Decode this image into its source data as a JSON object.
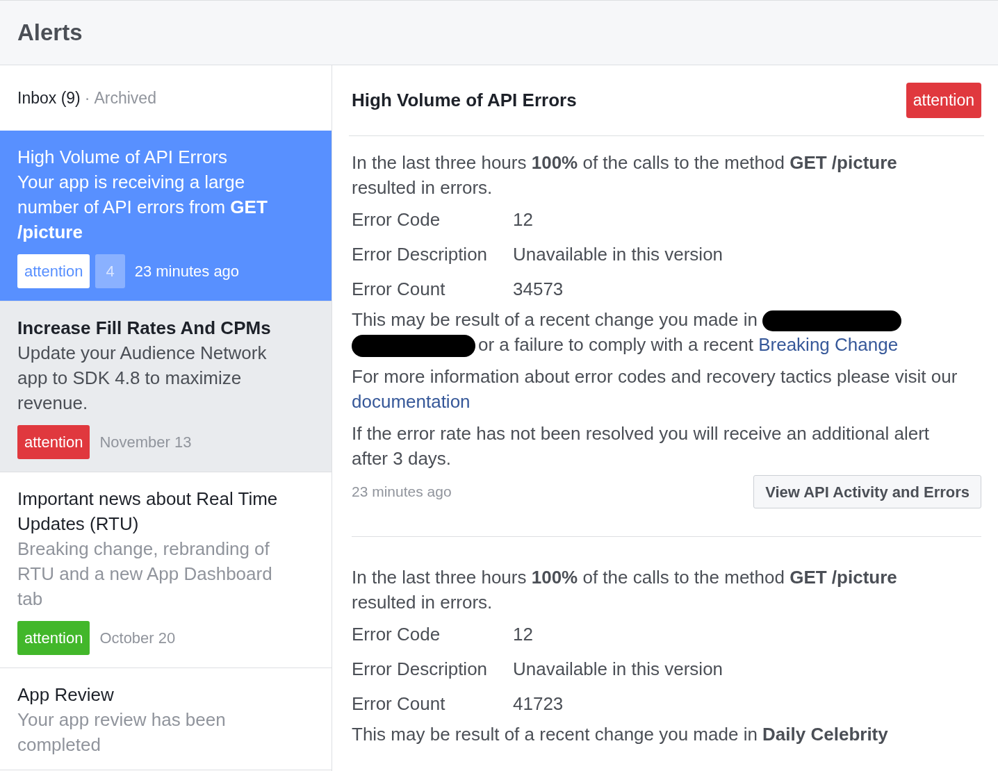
{
  "header": {
    "title": "Alerts"
  },
  "inbox_tabs": [
    {
      "label": "Inbox (9)",
      "selected": true
    },
    {
      "label": "Archived",
      "selected": false
    }
  ],
  "tab_separator": "·",
  "alerts": [
    {
      "title": "High Volume of API Errors",
      "body": "Your app is receiving a large number of API errors from **GET /picture**",
      "selected": true,
      "unread": false,
      "badge": {
        "label": "attention",
        "color": "#5890ff"
      },
      "count": "4",
      "time": "23 minutes ago"
    },
    {
      "title": "Increase Fill Rates And CPMs",
      "body": "Update your Audience Network app to SDK 4.8 to maximize revenue.",
      "selected": false,
      "unread": true,
      "badge": {
        "label": "attention",
        "color": "#e0383e"
      },
      "time": "November 13"
    },
    {
      "title": "Important news about Real Time Updates (RTU)",
      "body": "Breaking change, rebranding of RTU and a new App Dashboard tab",
      "selected": false,
      "unread": false,
      "badge": {
        "label": "attention",
        "color": "#42b72a"
      },
      "time": "October 20"
    },
    {
      "title": "App Review",
      "body": "Your app review has been completed",
      "selected": false,
      "unread": false
    }
  ],
  "detail": {
    "title": "High Volume of API Errors",
    "badge": {
      "label": "attention",
      "color": "#e0383e"
    },
    "entries": [
      {
        "blocks": [
          {
            "kind": "text",
            "text": "In the last three hours **100%** of the calls to the method **GET /picture** resulted in errors."
          },
          {
            "kind": "field",
            "label": "Error Code",
            "value": "12"
          },
          {
            "kind": "field",
            "label": "Error Description",
            "value": "Unavailable in this version"
          },
          {
            "kind": "field",
            "label": "Error Count",
            "value": "34573"
          },
          {
            "kind": "redacted",
            "before": "This may be result of a recent change you made in",
            "after": "or a failure to comply with a recent",
            "link": "Breaking Change"
          },
          {
            "kind": "linked",
            "text": "For more information about error codes and recovery tactics please visit our",
            "link": "documentation"
          },
          {
            "kind": "text",
            "text": "If the error rate has not been resolved you will receive an additional alert after 3 days."
          },
          {
            "kind": "footer",
            "time": "23 minutes ago",
            "action": "View API Activity and Errors"
          }
        ]
      },
      {
        "blocks": [
          {
            "kind": "text",
            "text": "In the last three hours **100%** of the calls to the method **GET /picture** resulted in errors."
          },
          {
            "kind": "field",
            "label": "Error Code",
            "value": "12"
          },
          {
            "kind": "field",
            "label": "Error Description",
            "value": "Unavailable in this version"
          },
          {
            "kind": "field",
            "label": "Error Count",
            "value": "41723"
          },
          {
            "kind": "text",
            "text": "This may be result of a recent change you made in **Daily Celebrity**"
          }
        ]
      }
    ]
  }
}
